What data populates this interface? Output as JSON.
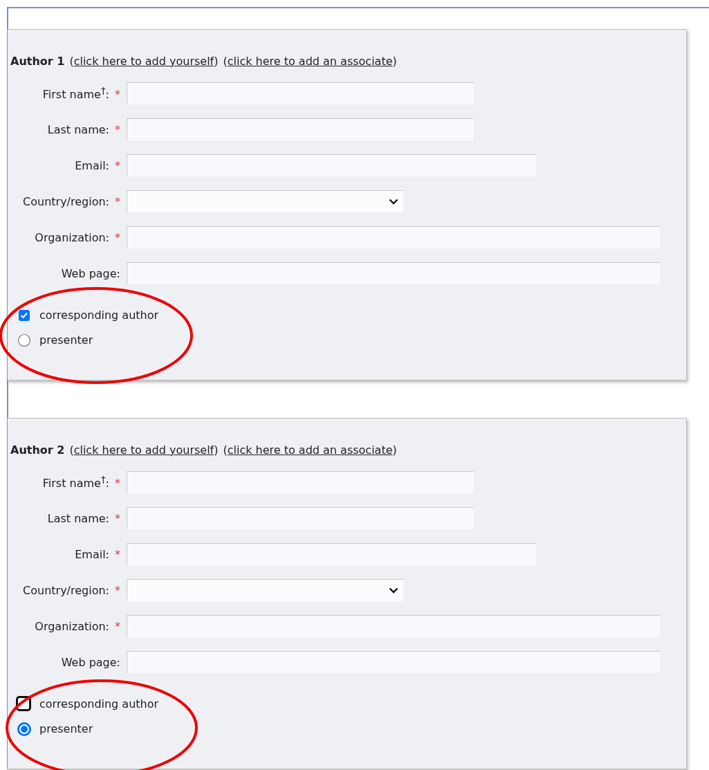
{
  "authors": [
    {
      "title": "Author 1",
      "links": [
        {
          "open": "(",
          "label": "click here to add yourself",
          "close": ")"
        },
        {
          "open": "(",
          "label": "click here to add an associate",
          "close": ")"
        }
      ],
      "fields": [
        {
          "kind": "text",
          "label": "First name$^{†}$:",
          "marker": "*"
        },
        {
          "kind": "text",
          "label": "Last name:",
          "marker": "*"
        },
        {
          "kind": "text",
          "label": "Email:",
          "marker": "*"
        },
        {
          "kind": "select",
          "label": "Country/region:",
          "marker": "*"
        },
        {
          "kind": "text",
          "label": "Organization:",
          "marker": "*"
        },
        {
          "kind": "text",
          "label": "Web page:"
        }
      ],
      "options": [
        {
          "kind": "checkbox",
          "label": "corresponding author",
          "checked": true,
          "focused": false
        },
        {
          "kind": "radio",
          "label": "presenter",
          "selected": false
        }
      ]
    },
    {
      "title": "Author 2",
      "links": [
        {
          "open": "(",
          "label": "click here to add yourself",
          "close": ")"
        },
        {
          "open": "(",
          "label": "click here to add an associate",
          "close": ")"
        }
      ],
      "fields": [
        {
          "kind": "text",
          "label": "First name$^{†}$:",
          "marker": "*"
        },
        {
          "kind": "text",
          "label": "Last name:",
          "marker": "*"
        },
        {
          "kind": "text",
          "label": "Email:",
          "marker": "*"
        },
        {
          "kind": "select",
          "label": "Country/region:",
          "marker": "*"
        },
        {
          "kind": "text",
          "label": "Organization:",
          "marker": "*"
        },
        {
          "kind": "text",
          "label": "Web page:"
        }
      ],
      "options": [
        {
          "kind": "checkbox",
          "label": "corresponding author",
          "checked": false,
          "focused": true
        },
        {
          "kind": "radio",
          "label": "presenter",
          "selected": true
        }
      ]
    }
  ]
}
